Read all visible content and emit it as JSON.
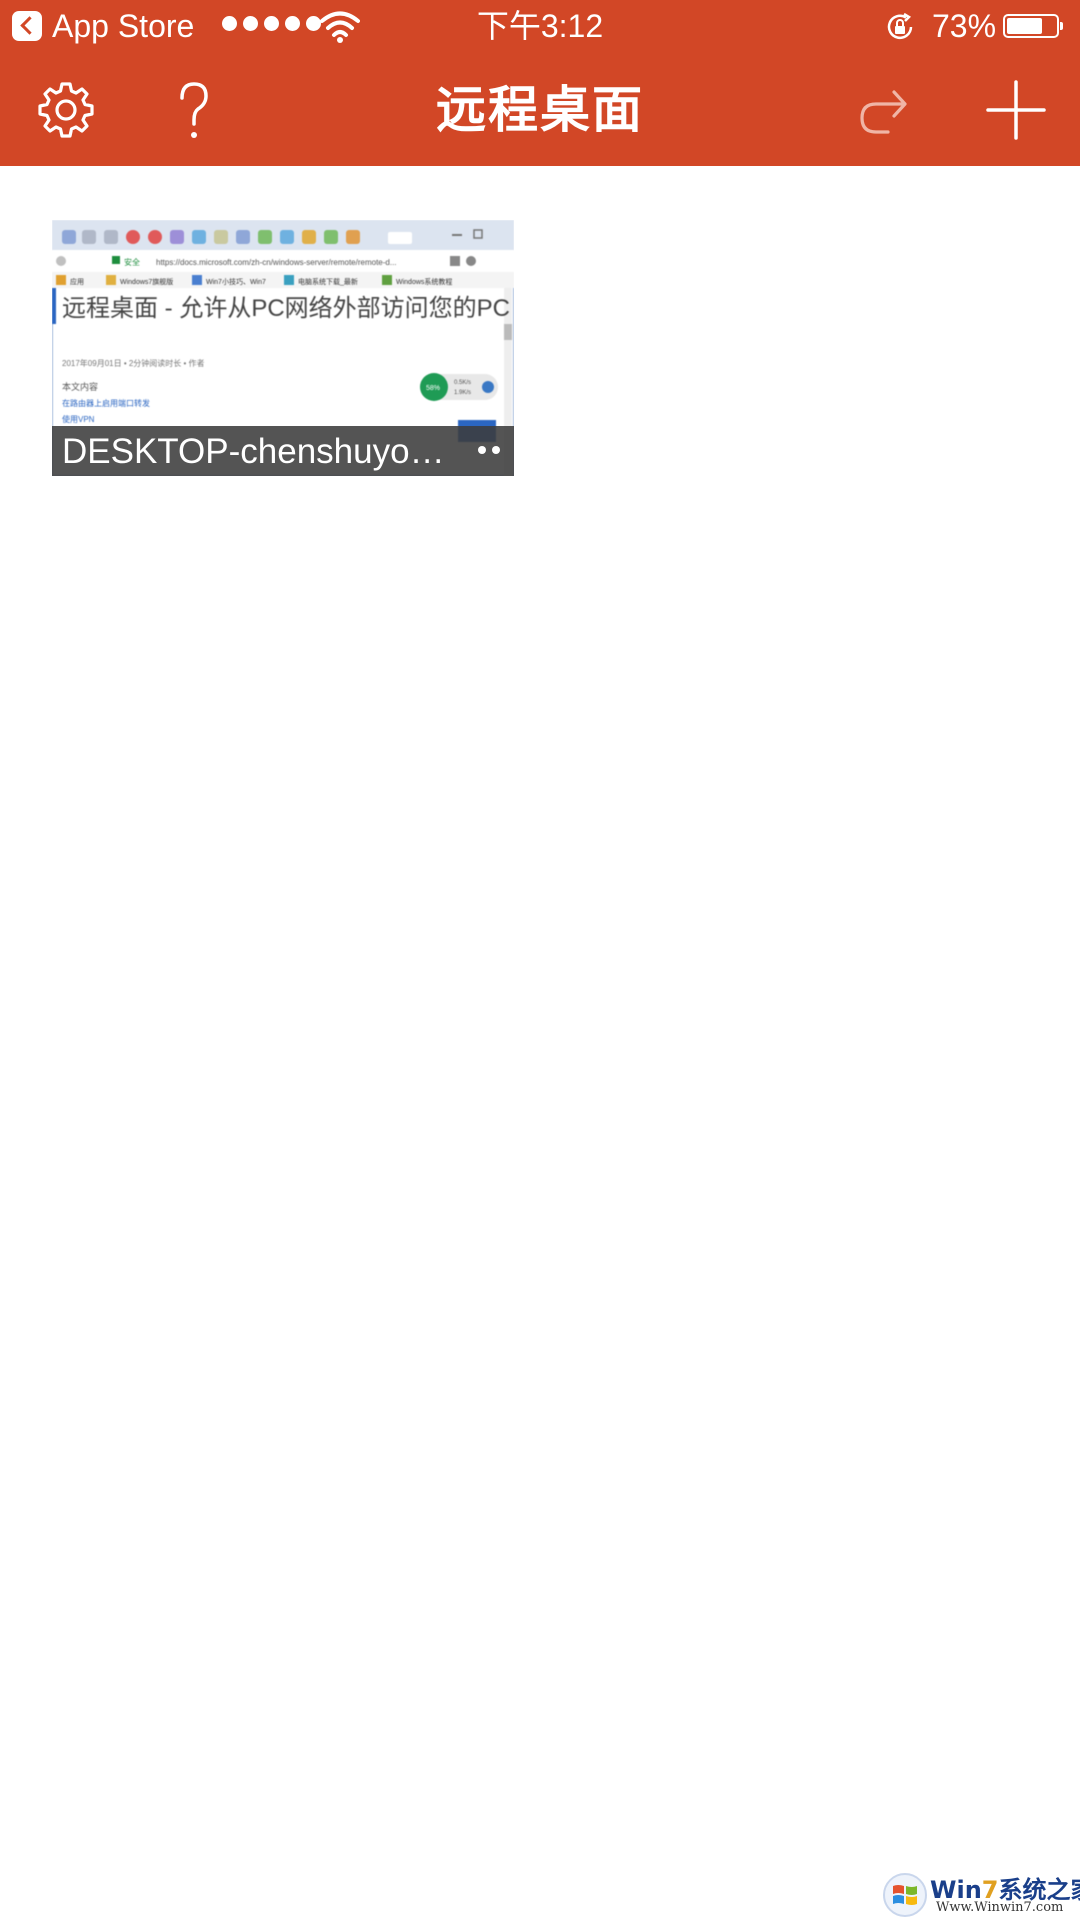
{
  "status_bar": {
    "back_app": "App Store",
    "time": "下午3:12",
    "battery_percent": "73%",
    "battery_level": 0.73,
    "signal_bars": 5
  },
  "nav": {
    "title": "远程桌面",
    "icons": {
      "settings": "gear-icon",
      "help": "question-icon",
      "redo": "redo-arrow-icon",
      "add": "plus-icon"
    }
  },
  "desktops": [
    {
      "name": "DESKTOP-chenshuyong…",
      "thumbnail": {
        "url_text": "https://docs.microsoft.com/zh-cn/windows-server/remote/remote-d...",
        "secure_label": "安全",
        "bookmarks": [
          "应用",
          "Windows7旗舰版",
          "Win7小技巧、Win7",
          "电脑系统下载_最新",
          "Windows系统教程"
        ],
        "heading": "远程桌面 - 允许从PC网络外部访问您的PC",
        "meta": "2017年09月01日 • 2分钟阅读时长 • 作者",
        "toc_label": "本文内容",
        "links": [
          "在路由器上启用端口转发",
          "使用VPN"
        ],
        "speed_badge": "58%",
        "speed_side": [
          "0.5K/s",
          "1.9K/s"
        ]
      }
    }
  ],
  "colors": {
    "accent": "#d24726",
    "caption_bg": "#3c3c3c"
  },
  "watermark": {
    "title_prefix": "Win",
    "title_digit": "7",
    "title_suffix": "系统之家",
    "url": "Www.Winwin7.com"
  }
}
